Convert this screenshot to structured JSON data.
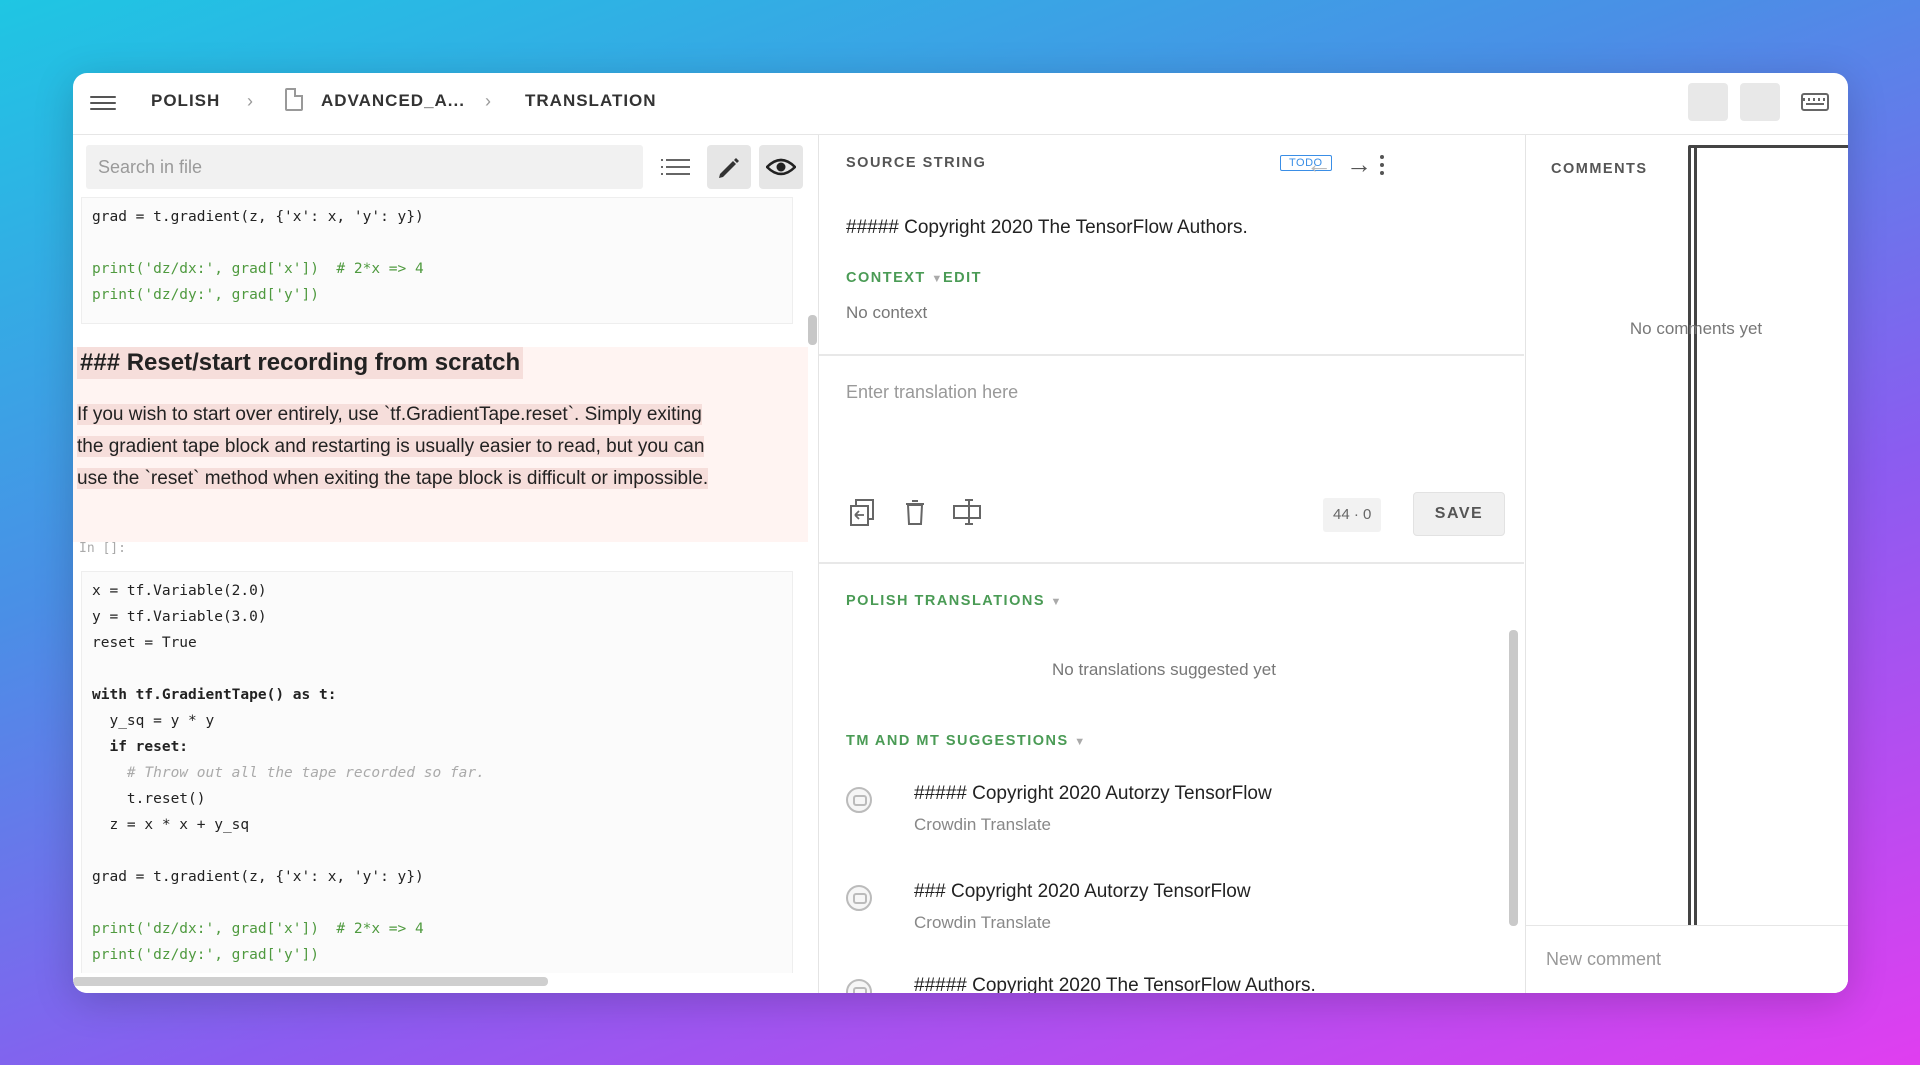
{
  "header": {
    "breadcrumb": [
      "POLISH",
      "ADVANCED_A...",
      "TRANSLATION"
    ]
  },
  "left": {
    "search_placeholder": "Search in file",
    "code_top": [
      "grad = t.gradient(z, {'x': x, 'y': y})",
      "",
      "print('dz/dx:', grad['x'])  # 2*x => 4",
      "print('dz/dy:', grad['y'])"
    ],
    "heading": "### Reset/start recording from scratch",
    "paragraph": [
      "If you wish to start over entirely, use `tf.GradientTape.reset`. Simply exiting",
      "the gradient tape block and restarting is usually easier to read, but you can",
      "use the `reset` method when exiting the tape block is difficult or impossible."
    ],
    "in_label": "In []:",
    "code_main": [
      "x = tf.Variable(2.0)",
      "y = tf.Variable(3.0)",
      "reset = True",
      "",
      "with tf.GradientTape() as t:",
      "  y_sq = y * y",
      "  if reset:",
      "    # Throw out all the tape recorded so far.",
      "    t.reset()",
      "  z = x * x + y_sq",
      "",
      "grad = t.gradient(z, {'x': x, 'y': y})",
      "",
      "print('dz/dx:', grad['x'])  # 2*x => 4",
      "print('dz/dy:', grad['y'])"
    ]
  },
  "editor": {
    "source_label": "SOURCE STRING",
    "status_badge": "TODO",
    "source_text": "##### Copyright 2020 The TensorFlow Authors.",
    "context_label": "CONTEXT",
    "edit_label": "EDIT",
    "context_text": "No context",
    "translation_placeholder": "Enter translation here",
    "counter": "44 · 0",
    "save_label": "SAVE",
    "translations_label": "POLISH TRANSLATIONS",
    "no_translations": "No translations suggested yet",
    "suggestions_label": "TM AND MT SUGGESTIONS",
    "suggestions": [
      {
        "text": "##### Copyright 2020 Autorzy TensorFlow",
        "source": "Crowdin Translate"
      },
      {
        "text": "### Copyright 2020 Autorzy TensorFlow",
        "source": "Crowdin Translate"
      },
      {
        "text": "##### Copyright 2020 The TensorFlow Authors.",
        "source": ""
      }
    ]
  },
  "comments": {
    "title": "COMMENTS",
    "empty": "No comments yet",
    "new_placeholder": "New comment"
  },
  "colors": {
    "accent_green": "#4a9b55",
    "badge_blue": "#3a8ee6",
    "highlight": "#f6dedb"
  }
}
